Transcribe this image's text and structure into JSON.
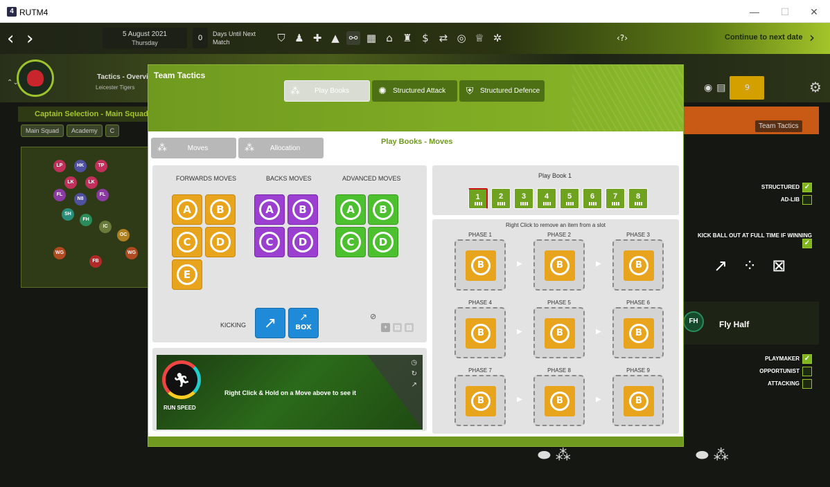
{
  "window": {
    "title": "RUTM4",
    "app_icon": "4"
  },
  "gamebar": {
    "date": "5 August 2021",
    "weekday": "Thursday",
    "days_count": "0",
    "days_label": "Days Until Next Match",
    "continue_label": "Continue to next date",
    "help_label": "?"
  },
  "background": {
    "tactics_title": "Tactics - Overvie",
    "club": "Leicester Tigers",
    "captain_title": "Captain Selection - Main Squad",
    "tabs": [
      "Main Squad",
      "Academy",
      "C"
    ],
    "team_tactics": "Team Tactics",
    "badge_count": "9",
    "structured": "STRUCTURED",
    "adlib": "AD-LIB",
    "kick_out": "KICK BALL OUT AT FULL TIME IF WINNING",
    "fly_half_abbr": "FH",
    "fly_half": "Fly Half",
    "playmaker": "PLAYMAKER",
    "opportunist": "OPPORTUNIST",
    "attacking": "ATTACKING",
    "pitch_players": [
      "LP",
      "HK",
      "TP",
      "LK",
      "LK",
      "FL",
      "N8",
      "FL",
      "SH",
      "FH",
      "IC",
      "OC",
      "WG",
      "WG",
      "FB"
    ]
  },
  "modal": {
    "title": "Team Tactics",
    "tabs": [
      "Play Books",
      "Structured Attack",
      "Structured Defence"
    ],
    "subtabs": [
      "Moves",
      "Allocation"
    ],
    "section_title": "Play Books - Moves",
    "col_forwards": "FORWARDS MOVES",
    "col_backs": "BACKS MOVES",
    "col_advanced": "ADVANCED MOVES",
    "forwards": [
      "A",
      "B",
      "C",
      "D",
      "E"
    ],
    "backs": [
      "A",
      "B",
      "C",
      "D"
    ],
    "advanced": [
      "A",
      "B",
      "C",
      "D"
    ],
    "kicking_label": "KICKING",
    "box_label": "BOX",
    "run_speed": "RUN SPEED",
    "hold_hint": "Right Click & Hold on a Move above to see it",
    "playbook_title": "Play Book 1",
    "playbook_slots": [
      "1",
      "2",
      "3",
      "4",
      "5",
      "6",
      "7",
      "8"
    ],
    "remove_hint": "Right Click to remove an item from a slot",
    "phases": [
      "PHASE 1",
      "PHASE 2",
      "PHASE 3",
      "PHASE 4",
      "PHASE 5",
      "PHASE 6",
      "PHASE 7",
      "PHASE 8",
      "PHASE 9"
    ],
    "phase_move": "B"
  },
  "colors": {
    "accent_green": "#82ae25",
    "forwards": "#e8a41c",
    "backs": "#9a3fd0",
    "advanced": "#4cc02e",
    "kicking": "#1f8bd8"
  }
}
